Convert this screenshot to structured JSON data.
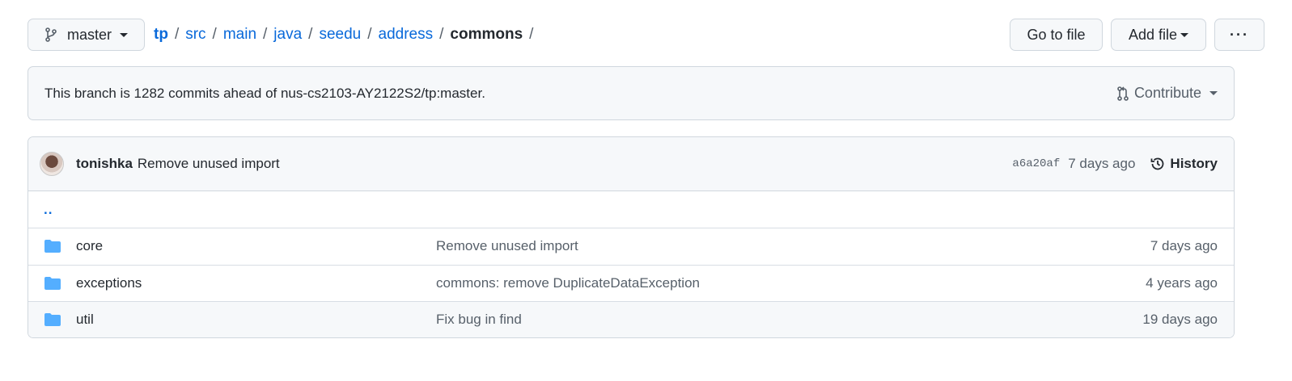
{
  "branch": {
    "name": "master"
  },
  "breadcrumb": {
    "root": "tp",
    "path": [
      "src",
      "main",
      "java",
      "seedu",
      "address"
    ],
    "current": "commons",
    "trailing_sep": "/"
  },
  "actions": {
    "go_to_file": "Go to file",
    "add_file": "Add file",
    "more": "···"
  },
  "branch_info": {
    "message": "This branch is 1282 commits ahead of nus-cs2103-AY2122S2/tp:master.",
    "contribute": "Contribute"
  },
  "latest_commit": {
    "author": "tonishka",
    "message": "Remove unused import",
    "sha": "a6a20af",
    "age": "7 days ago",
    "history": "History"
  },
  "parent_link": "..",
  "files": [
    {
      "name": "core",
      "message": "Remove unused import",
      "age": "7 days ago"
    },
    {
      "name": "exceptions",
      "message": "commons: remove DuplicateDataException",
      "age": "4 years ago"
    },
    {
      "name": "util",
      "message": "Fix bug in find",
      "age": "19 days ago"
    }
  ],
  "colors": {
    "link": "#0969da",
    "folder": "#54aeff",
    "border": "#d0d7de",
    "muted": "#57606a"
  }
}
